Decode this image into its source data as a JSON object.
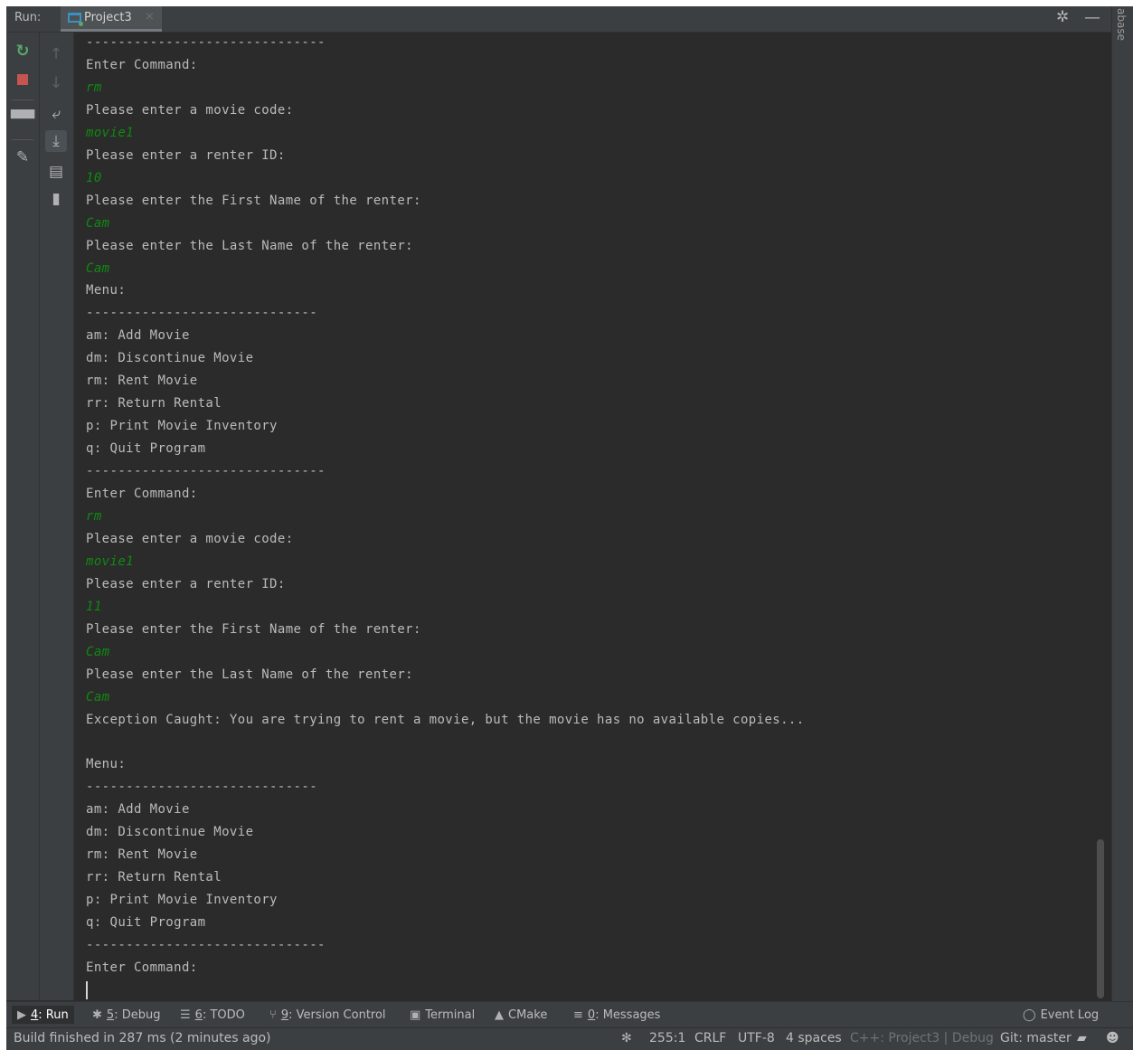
{
  "titlebar": {
    "run_label": "Run:",
    "tab_label": "Project3",
    "close_glyph": "×",
    "side_tab_text": "abase",
    "gear_icon": "gear-icon",
    "minimize_icon": "minimize-icon"
  },
  "console": {
    "lines": [
      {
        "text": "------------------------------",
        "kind": "out"
      },
      {
        "text": "Enter Command:",
        "kind": "out"
      },
      {
        "text": "rm",
        "kind": "in"
      },
      {
        "text": "Please enter a movie code:",
        "kind": "out"
      },
      {
        "text": "movie1",
        "kind": "in"
      },
      {
        "text": "Please enter a renter ID:",
        "kind": "out"
      },
      {
        "text": "10",
        "kind": "in"
      },
      {
        "text": "Please enter the First Name of the renter:",
        "kind": "out"
      },
      {
        "text": "Cam",
        "kind": "in"
      },
      {
        "text": "Please enter the Last Name of the renter:",
        "kind": "out"
      },
      {
        "text": "Cam",
        "kind": "in"
      },
      {
        "text": "Menu:",
        "kind": "out"
      },
      {
        "text": "-----------------------------",
        "kind": "out"
      },
      {
        "text": "am: Add Movie",
        "kind": "out"
      },
      {
        "text": "dm: Discontinue Movie",
        "kind": "out"
      },
      {
        "text": "rm: Rent Movie",
        "kind": "out"
      },
      {
        "text": "rr: Return Rental",
        "kind": "out"
      },
      {
        "text": "p: Print Movie Inventory",
        "kind": "out"
      },
      {
        "text": "q: Quit Program",
        "kind": "out"
      },
      {
        "text": "------------------------------",
        "kind": "out"
      },
      {
        "text": "Enter Command:",
        "kind": "out"
      },
      {
        "text": "rm",
        "kind": "in"
      },
      {
        "text": "Please enter a movie code:",
        "kind": "out"
      },
      {
        "text": "movie1",
        "kind": "in"
      },
      {
        "text": "Please enter a renter ID:",
        "kind": "out"
      },
      {
        "text": "11",
        "kind": "in"
      },
      {
        "text": "Please enter the First Name of the renter:",
        "kind": "out"
      },
      {
        "text": "Cam",
        "kind": "in"
      },
      {
        "text": "Please enter the Last Name of the renter:",
        "kind": "out"
      },
      {
        "text": "Cam",
        "kind": "in"
      },
      {
        "text": "Exception Caught: You are trying to rent a movie, but the movie has no available copies...",
        "kind": "out"
      },
      {
        "text": "",
        "kind": "out"
      },
      {
        "text": "Menu:",
        "kind": "out"
      },
      {
        "text": "-----------------------------",
        "kind": "out"
      },
      {
        "text": "am: Add Movie",
        "kind": "out"
      },
      {
        "text": "dm: Discontinue Movie",
        "kind": "out"
      },
      {
        "text": "rm: Rent Movie",
        "kind": "out"
      },
      {
        "text": "rr: Return Rental",
        "kind": "out"
      },
      {
        "text": "p: Print Movie Inventory",
        "kind": "out"
      },
      {
        "text": "q: Quit Program",
        "kind": "out"
      },
      {
        "text": "------------------------------",
        "kind": "out"
      },
      {
        "text": "Enter Command:",
        "kind": "out"
      }
    ]
  },
  "bottom_tabs": [
    {
      "num": "4",
      "label": ": Run",
      "icon": "run-icon",
      "glyph": "▶",
      "selected": true
    },
    {
      "num": "5",
      "label": ": Debug",
      "icon": "bug-icon",
      "glyph": "✱",
      "selected": false
    },
    {
      "num": "6",
      "label": ": TODO",
      "icon": "list-icon",
      "glyph": "☰",
      "selected": false
    },
    {
      "num": "9",
      "label": ": Version Control",
      "icon": "vcs-icon",
      "glyph": "⑂",
      "selected": false
    },
    {
      "num": "",
      "label": "Terminal",
      "icon": "terminal-icon",
      "glyph": "▣",
      "selected": false
    },
    {
      "num": "",
      "label": "CMake",
      "icon": "cmake-icon",
      "glyph": "▲",
      "selected": false
    },
    {
      "num": "0",
      "label": ": Messages",
      "icon": "messages-icon",
      "glyph": "≡",
      "selected": false
    }
  ],
  "event_log": {
    "label": "Event Log",
    "glyph": "◯"
  },
  "status": {
    "build": "Build finished in 287 ms (2 minutes ago)",
    "position": "255:1",
    "line_sep": "CRLF",
    "encoding": "UTF-8",
    "indent": "4 spaces",
    "context": "C++: Project3 | Debug",
    "git": "Git: master"
  }
}
